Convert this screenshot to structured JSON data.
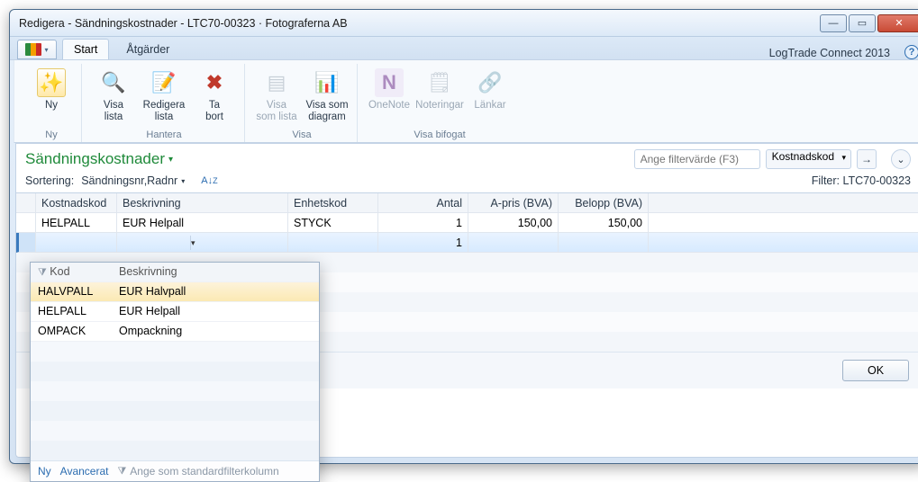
{
  "window": {
    "title": "Redigera - Sändningskostnader - LTC70-00323 · Fotograferna AB"
  },
  "app": {
    "name": "LogTrade Connect 2013"
  },
  "tabs": [
    {
      "label": "Start",
      "active": true
    },
    {
      "label": "Åtgärder",
      "active": false
    }
  ],
  "ribbon": {
    "groups": [
      {
        "label": "Ny",
        "items": [
          {
            "key": "ny",
            "label": "Ny",
            "icon": "✳"
          }
        ]
      },
      {
        "label": "Hantera",
        "items": [
          {
            "key": "visa-lista",
            "label": "Visa\nlista",
            "icon": "🔍"
          },
          {
            "key": "redigera-lista",
            "label": "Redigera\nlista",
            "icon": "📄"
          },
          {
            "key": "ta-bort",
            "label": "Ta\nbort",
            "icon": "✖",
            "iconColor": "#c0392b"
          }
        ]
      },
      {
        "label": "Visa",
        "items": [
          {
            "key": "visa-som-lista",
            "label": "Visa\nsom lista",
            "icon": "▤",
            "disabled": true
          },
          {
            "key": "visa-som-diagram",
            "label": "Visa som\ndiagram",
            "icon": "📊"
          }
        ]
      },
      {
        "label": "Visa bifogat",
        "items": [
          {
            "key": "onenote",
            "label": "OneNote",
            "icon": "N",
            "iconColor": "#7b4397",
            "disabled": true
          },
          {
            "key": "noteringar",
            "label": "Noteringar",
            "icon": "🗒",
            "disabled": true
          },
          {
            "key": "lankar",
            "label": "Länkar",
            "icon": "🔗",
            "disabled": true
          }
        ]
      }
    ]
  },
  "page": {
    "title": "Sändningskostnader"
  },
  "filter": {
    "placeholder": "Ange filtervärde (F3)",
    "column": "Kostnadskod",
    "applied": "LTC70-00323",
    "filter_label": "Filter:"
  },
  "sort": {
    "label": "Sortering:",
    "value": "Sändningsnr,Radnr"
  },
  "grid": {
    "headers": [
      "Kostnadskod",
      "Beskrivning",
      "Enhetskod",
      "Antal",
      "A-pris (BVA)",
      "Belopp (BVA)"
    ],
    "rows": [
      {
        "kostnadskod": "HELPALL",
        "beskrivning": "EUR Helpall",
        "enhetskod": "STYCK",
        "antal": "1",
        "apris": "150,00",
        "belopp": "150,00"
      },
      {
        "kostnadskod": "",
        "beskrivning": "",
        "enhetskod": "",
        "antal": "1",
        "apris": "",
        "belopp": "",
        "editing": true
      }
    ]
  },
  "dropdown": {
    "headers": {
      "kod": "Kod",
      "beskrivning": "Beskrivning"
    },
    "rows": [
      {
        "kod": "HALVPALL",
        "beskrivning": "EUR Halvpall",
        "highlight": true
      },
      {
        "kod": "HELPALL",
        "beskrivning": "EUR Helpall"
      },
      {
        "kod": "OMPACK",
        "beskrivning": "Ompackning"
      }
    ],
    "footer": {
      "ny": "Ny",
      "avancerat": "Avancerat",
      "set_default": "Ange som standardfilterkolumn"
    }
  },
  "buttons": {
    "ok": "OK"
  }
}
